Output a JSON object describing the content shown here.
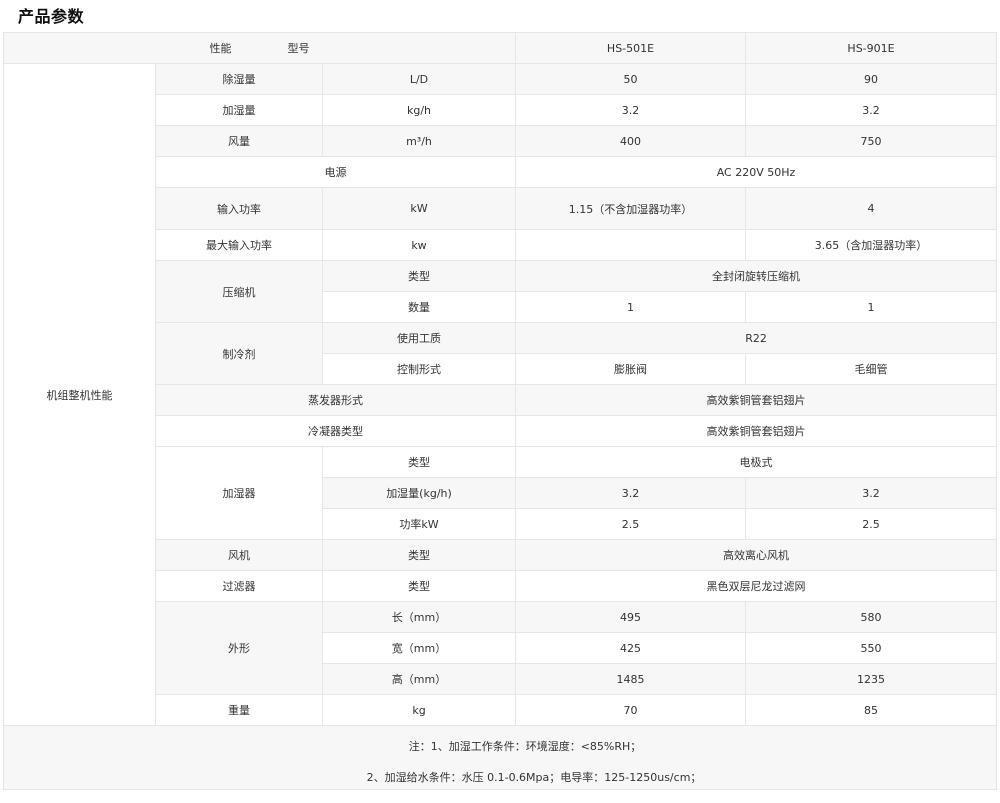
{
  "page_title": "产品参数",
  "header": {
    "performance_label": "性能",
    "model_label": "型号",
    "models": [
      "HS-501E",
      "HS-901E"
    ]
  },
  "group_label": "机组整机性能",
  "rows": {
    "dehumid": {
      "label": "除湿量",
      "unit": "L/D",
      "v1": "50",
      "v2": "90"
    },
    "humid": {
      "label": "加湿量",
      "unit": "kg/h",
      "v1": "3.2",
      "v2": "3.2"
    },
    "airflow": {
      "label": "风量",
      "unit": "m³/h",
      "v1": "400",
      "v2": "750"
    },
    "power_supply": {
      "label": "电源",
      "value": "AC 220V 50Hz"
    },
    "input_power": {
      "label": "输入功率",
      "unit": "kW",
      "v1": "1.15（不含加湿器功率）",
      "v2": "4"
    },
    "max_input_power": {
      "label": "最大输入功率",
      "unit": "kw",
      "v1": "",
      "v2": "3.65（含加湿器功率）"
    },
    "compressor": {
      "label": "压缩机",
      "type_label": "类型",
      "type_value": "全封闭旋转压缩机",
      "qty_label": "数量",
      "qty_v1": "1",
      "qty_v2": "1"
    },
    "refrigerant": {
      "label": "制冷剂",
      "medium_label": "使用工质",
      "medium_value": "R22",
      "control_label": "控制形式",
      "control_v1": "膨胀阀",
      "control_v2": "毛细管"
    },
    "evaporator": {
      "label": "蒸发器形式",
      "value": "高效紫铜管套铝翅片"
    },
    "condenser": {
      "label": "冷凝器类型",
      "value": "高效紫铜管套铝翅片"
    },
    "humidifier": {
      "label": "加湿器",
      "type_label": "类型",
      "type_value": "电极式",
      "amount_label": "加湿量(kg/h)",
      "amount_v1": "3.2",
      "amount_v2": "3.2",
      "power_label": "功率kW",
      "power_v1": "2.5",
      "power_v2": "2.5"
    },
    "fan": {
      "label": "风机",
      "type_label": "类型",
      "value": "高效离心风机"
    },
    "filter": {
      "label": "过滤器",
      "type_label": "类型",
      "value": "黑色双层尼龙过滤网"
    },
    "dimensions": {
      "label": "外形",
      "length_label": "长（mm）",
      "length_v1": "495",
      "length_v2": "580",
      "width_label": "宽（mm）",
      "width_v1": "425",
      "width_v2": "550",
      "height_label": "高（mm）",
      "height_v1": "1485",
      "height_v2": "1235"
    },
    "weight": {
      "label": "重量",
      "unit": "kg",
      "v1": "70",
      "v2": "85"
    }
  },
  "notes": [
    "注：1、加湿工作条件：环境湿度：<85%RH；",
    "2、加湿给水条件：水压 0.1-0.6Mpa；电导率：125-1250us/cm；"
  ],
  "colors": {
    "shaded_cell": "#f7f7f7",
    "border": "#e6e6e6",
    "text": "#333333"
  }
}
